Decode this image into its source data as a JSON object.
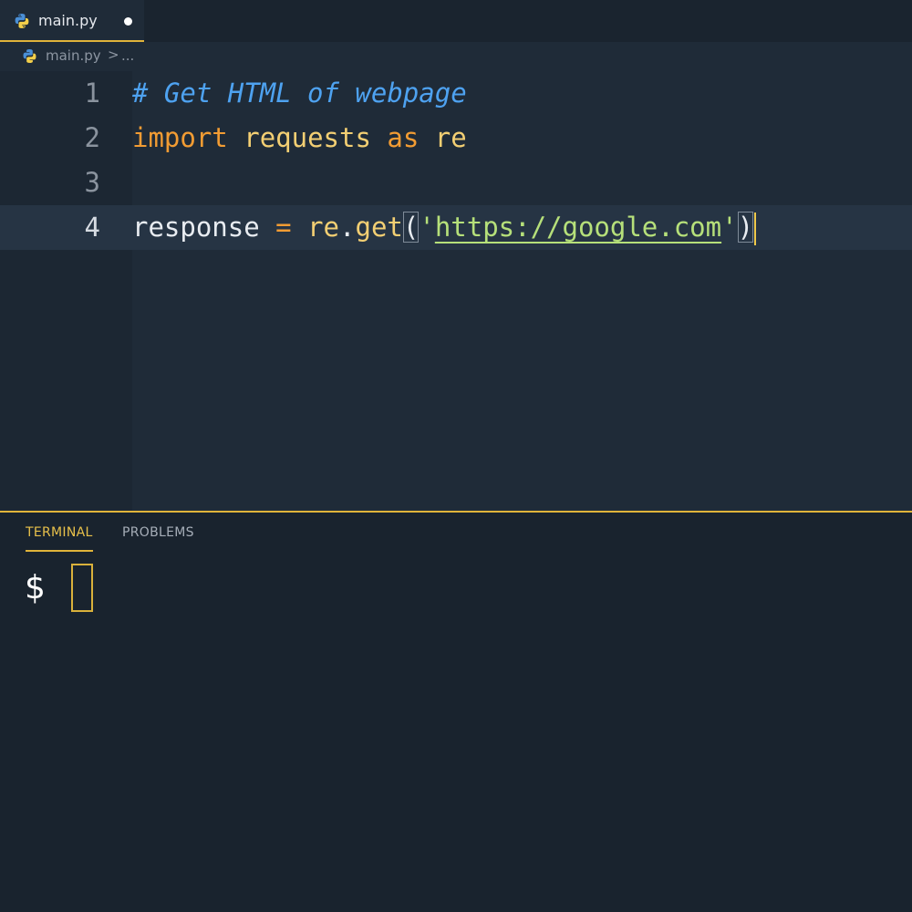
{
  "tab": {
    "filename": "main.py",
    "icon": "python-icon",
    "unsaved": true
  },
  "breadcrumb": {
    "file": "main.py",
    "separator": ">",
    "more": "..."
  },
  "editor": {
    "lines": [
      {
        "number": "1",
        "comment": "# Get HTML of webpage"
      },
      {
        "number": "2",
        "kw_import": "import",
        "module": "requests",
        "kw_as": "as",
        "alias": "re"
      },
      {
        "number": "3"
      },
      {
        "number": "4",
        "var": "response",
        "op": "=",
        "obj": "re",
        "dot": ".",
        "method": "get",
        "open_paren": "(",
        "quote_open": "'",
        "url": "https://google.com",
        "quote_close": "'",
        "close_paren": ")"
      }
    ],
    "current_line": 4
  },
  "panel": {
    "tabs": [
      {
        "label": "TERMINAL",
        "active": true
      },
      {
        "label": "PROBLEMS",
        "active": false
      }
    ],
    "prompt": "$"
  },
  "colors": {
    "accent": "#e0b43a",
    "comment": "#4ea2f0",
    "keyword": "#f29c33",
    "string": "#b6e07a"
  }
}
